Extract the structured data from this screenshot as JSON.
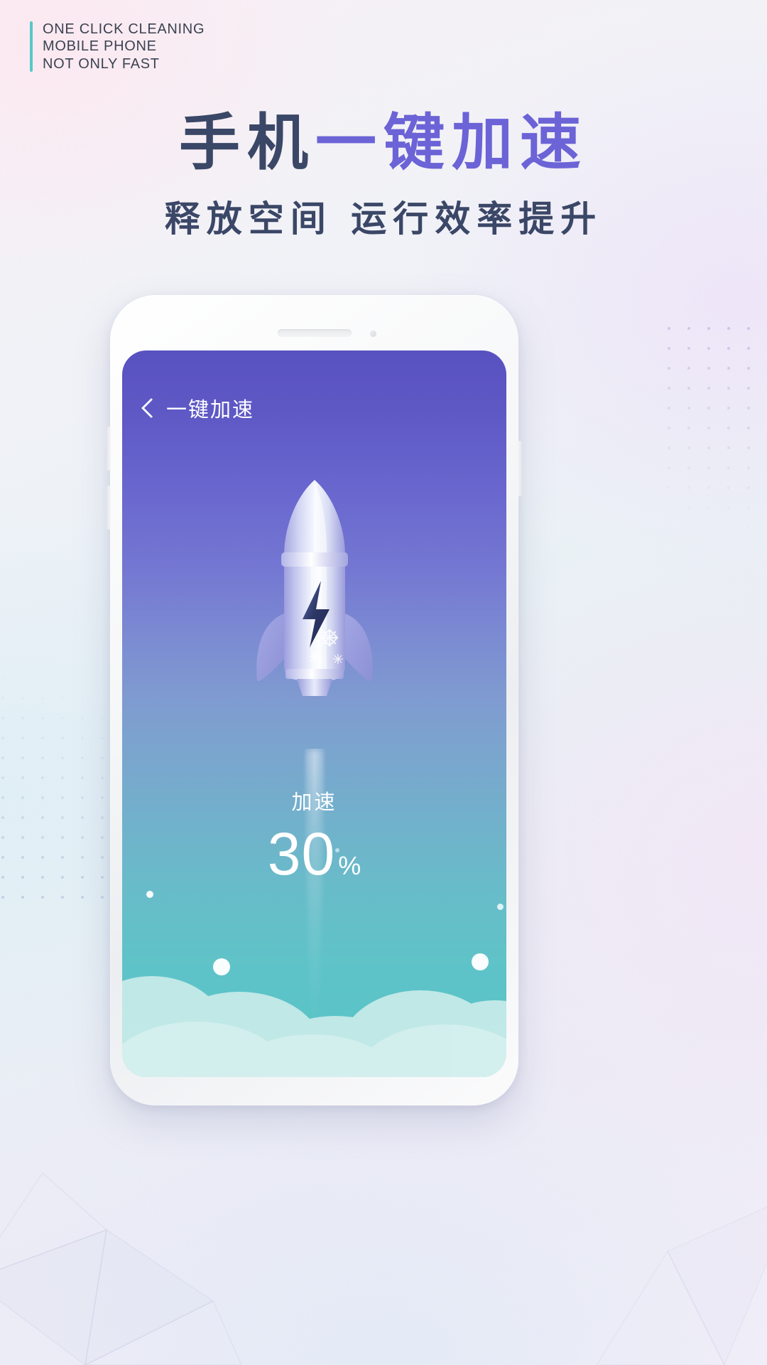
{
  "kicker": {
    "lines": [
      "ONE CLICK CLEANING",
      "MOBILE PHONE",
      "NOT ONLY FAST"
    ],
    "bar_color": "#56c8c8",
    "text_color": "#3b4352"
  },
  "headline": {
    "dark_part": "手机",
    "purple_part": "一键加速",
    "dark_color": "#3b4767",
    "purple_color": "#6b63d6"
  },
  "subheadline": {
    "text": "释放空间 运行效率提升",
    "color": "#3b4767"
  },
  "phone_screen": {
    "navbar": {
      "back_icon": "chevron-left-icon",
      "title": "一键加速"
    },
    "illustration": {
      "name": "rocket-illustration",
      "body_badge_icon": "lightning-bolt-icon",
      "decor_icon": "snowflake-icon",
      "exhaust": "plume"
    },
    "stat": {
      "label": "加速",
      "value": "30",
      "unit": "%"
    },
    "gradient_top": "#5851c0",
    "gradient_mid": "#7f9bd0",
    "gradient_bottom": "#55c4c6",
    "cloud_color": "#c7ecea"
  }
}
